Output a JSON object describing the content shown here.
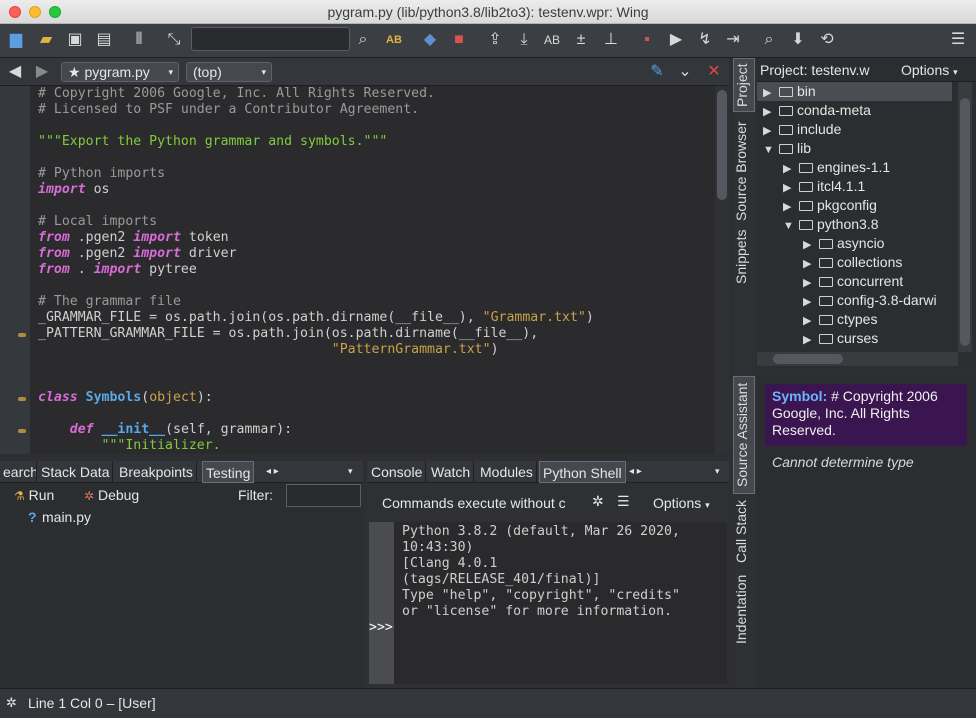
{
  "window": {
    "title": "pygram.py (lib/python3.8/lib2to3): testenv.wpr: Wing"
  },
  "toolbar": {
    "search_placeholder": ""
  },
  "editor": {
    "file_tab": "pygram.py",
    "scope": "(top)",
    "lines": [
      [
        [
          "cm",
          "# Copyright 2006 Google, Inc. All Rights Reserved."
        ]
      ],
      [
        [
          "cm",
          "# Licensed to PSF under a Contributor Agreement."
        ]
      ],
      [],
      [
        [
          "ds",
          "\"\"\"Export the Python grammar and symbols.\"\"\""
        ]
      ],
      [],
      [
        [
          "cm",
          "# Python imports"
        ]
      ],
      [
        [
          "kw",
          "import"
        ],
        [
          "nm",
          " os"
        ]
      ],
      [],
      [
        [
          "cm",
          "# Local imports"
        ]
      ],
      [
        [
          "kw",
          "from"
        ],
        [
          "nm",
          " .pgen2 "
        ],
        [
          "kw",
          "import"
        ],
        [
          "nm",
          " token"
        ]
      ],
      [
        [
          "kw",
          "from"
        ],
        [
          "nm",
          " .pgen2 "
        ],
        [
          "kw",
          "import"
        ],
        [
          "nm",
          " driver"
        ]
      ],
      [
        [
          "kw",
          "from"
        ],
        [
          "nm",
          " . "
        ],
        [
          "kw",
          "import"
        ],
        [
          "nm",
          " pytree"
        ]
      ],
      [],
      [
        [
          "cm",
          "# The grammar file"
        ]
      ],
      [
        [
          "nm",
          "_GRAMMAR_FILE = os.path.join(os.path.dirname(__file__), "
        ],
        [
          "st",
          "\"Grammar.txt\""
        ],
        [
          "nm",
          ")"
        ]
      ],
      [
        [
          "nm",
          "_PATTERN_GRAMMAR_FILE = os.path.join(os.path.dirname(__file__),"
        ]
      ],
      [
        [
          "nm",
          "                                     "
        ],
        [
          "st",
          "\"PatternGrammar.txt\""
        ],
        [
          "nm",
          ")"
        ]
      ],
      [],
      [],
      [
        [
          "kw",
          "class"
        ],
        [
          "nm",
          " "
        ],
        [
          "fn",
          "Symbols"
        ],
        [
          "nm",
          "("
        ],
        [
          "st",
          "object"
        ],
        [
          "nm",
          "):"
        ]
      ],
      [],
      [
        [
          "nm",
          "    "
        ],
        [
          "kw",
          "def"
        ],
        [
          "nm",
          " "
        ],
        [
          "fn",
          "__init__"
        ],
        [
          "nm",
          "(self, grammar):"
        ]
      ],
      [
        [
          "nm",
          "        "
        ],
        [
          "ds",
          "\"\"\"Initializer."
        ]
      ]
    ]
  },
  "project": {
    "title": "Project: testenv.w",
    "options": "Options",
    "items": [
      {
        "label": "bin",
        "depth": 0,
        "open": false
      },
      {
        "label": "conda-meta",
        "depth": 0,
        "open": false
      },
      {
        "label": "include",
        "depth": 0,
        "open": false
      },
      {
        "label": "lib",
        "depth": 0,
        "open": true
      },
      {
        "label": "engines-1.1",
        "depth": 1,
        "open": false
      },
      {
        "label": "itcl4.1.1",
        "depth": 1,
        "open": false
      },
      {
        "label": "pkgconfig",
        "depth": 1,
        "open": false
      },
      {
        "label": "python3.8",
        "depth": 1,
        "open": true
      },
      {
        "label": "asyncio",
        "depth": 2,
        "open": false
      },
      {
        "label": "collections",
        "depth": 2,
        "open": false
      },
      {
        "label": "concurrent",
        "depth": 2,
        "open": false
      },
      {
        "label": "config-3.8-darwi",
        "depth": 2,
        "open": false
      },
      {
        "label": "ctypes",
        "depth": 2,
        "open": false
      },
      {
        "label": "curses",
        "depth": 2,
        "open": false
      }
    ]
  },
  "right_tabs": {
    "top": [
      "Project",
      "Source Browser",
      "Snippets"
    ],
    "bottom": [
      "Source Assistant",
      "Call Stack",
      "Indentation"
    ]
  },
  "source_assistant": {
    "symbol_label": "Symbol:",
    "symbol_text": "# Copyright 2006 Google, Inc. All Rights Reserved.",
    "type_text": "Cannot determine type"
  },
  "bottom_left": {
    "tabs": [
      "earch",
      "Stack Data",
      "Breakpoints",
      "Testing"
    ],
    "run": "Run",
    "debug": "Debug",
    "filter": "Filter:",
    "test_file_prefix": "?",
    "test_file": "main.py"
  },
  "bottom_right": {
    "tabs": [
      "Console",
      "Watch",
      "Modules",
      "Python Shell"
    ],
    "commands": "Commands execute without c",
    "options": "Options",
    "prompt": ">>>",
    "shell_lines": [
      "Python 3.8.2 (default, Mar 26 2020,",
      "10:43:30)",
      "[Clang 4.0.1",
      "(tags/RELEASE_401/final)]",
      "Type \"help\", \"copyright\", \"credits\"",
      "or \"license\" for more information."
    ]
  },
  "status": {
    "text": "Line 1 Col 0 – [User]"
  },
  "colors": {
    "comment": "#9a9a9a",
    "keyword": "#d86cd6",
    "string": "#c9a24a",
    "docstring": "#7fcd3c",
    "function": "#5aa9e6",
    "symbol_bg": "#3a1550",
    "symbol_label": "#6fb3ff"
  }
}
